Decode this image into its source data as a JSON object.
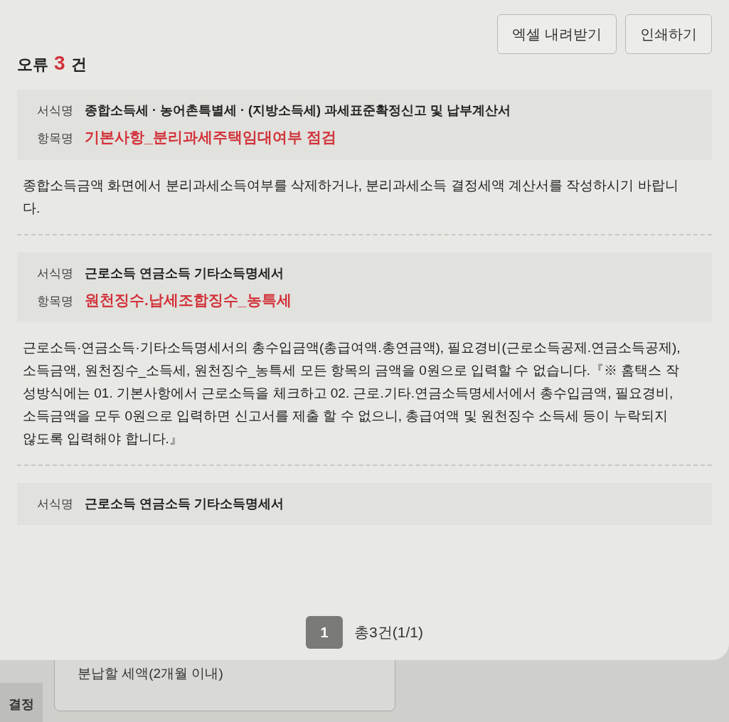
{
  "header": {
    "title_prefix": "오류",
    "count": "3",
    "title_suffix": "건",
    "buttons": [
      "엑셀 내려받기",
      "인쇄하기"
    ]
  },
  "errors": [
    {
      "form_label": "서식명",
      "form_name": "종합소득세 · 농어촌특별세 · (지방소득세) 과세표준확정신고 및 납부계산서",
      "item_label": "항목명",
      "item_name": "기본사항_분리과세주택임대여부 점검",
      "message": "종합소득금액 화면에서 분리과세소득여부를 삭제하거나, 분리과세소득 결정세액 계산서를 작성하시기 바랍니다."
    },
    {
      "form_label": "서식명",
      "form_name": "근로소득 연금소득 기타소득명세서",
      "item_label": "항목명",
      "item_name": "원천징수.납세조합징수_농특세",
      "message": "근로소득·연금소득·기타소득명세서의 총수입금액(총급여액.총연금액), 필요경비(근로소득공제.연금소득공제), 소득금액, 원천징수_소득세, 원천징수_농특세 모든 항목의 금액을 0원으로 입력할 수 없습니다.『※ 홈택스 작성방식에는 01. 기본사항에서 근로소득을 체크하고 02. 근로.기타.연금소득명세서에서 총수입금액, 필요경비, 소득금액을 모두 0원으로 입력하면 신고서를 제출 할 수 없으니, 총급여액 및 원천징수 소득세 등이 누락되지 않도록 입력해야 합니다.』"
    },
    {
      "form_label": "서식명",
      "form_name": "근로소득 연금소득 기타소득명세서"
    }
  ],
  "pagination": {
    "pages": [
      {
        "label": "1",
        "selected": true
      }
    ],
    "summary": "총3건(1/1)"
  },
  "background": {
    "tab": "결정",
    "field_label": "분납할 세액(2개월 이내)"
  }
}
